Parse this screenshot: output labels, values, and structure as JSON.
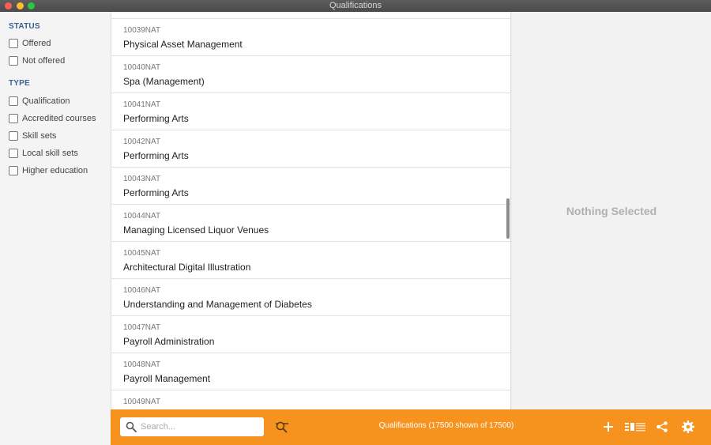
{
  "window": {
    "title": "Qualifications"
  },
  "sidebar": {
    "status_title": "STATUS",
    "status_items": [
      {
        "label": "Offered"
      },
      {
        "label": "Not offered"
      }
    ],
    "type_title": "TYPE",
    "type_items": [
      {
        "label": "Qualification"
      },
      {
        "label": "Accredited courses"
      },
      {
        "label": "Skill sets"
      },
      {
        "label": "Local skill sets"
      },
      {
        "label": "Higher education"
      }
    ]
  },
  "list": {
    "items": [
      {
        "code": "10039NAT",
        "name": "Physical Asset Management"
      },
      {
        "code": "10040NAT",
        "name": "Spa (Management)"
      },
      {
        "code": "10041NAT",
        "name": "Performing Arts"
      },
      {
        "code": "10042NAT",
        "name": "Performing Arts"
      },
      {
        "code": "10043NAT",
        "name": "Performing Arts"
      },
      {
        "code": "10044NAT",
        "name": "Managing Licensed Liquor Venues"
      },
      {
        "code": "10045NAT",
        "name": "Architectural Digital Illustration"
      },
      {
        "code": "10046NAT",
        "name": "Understanding and Management of Diabetes"
      },
      {
        "code": "10047NAT",
        "name": "Payroll Administration"
      },
      {
        "code": "10048NAT",
        "name": "Payroll Management"
      },
      {
        "code": "10049NAT",
        "name": ""
      }
    ]
  },
  "detail": {
    "empty_text": "Nothing Selected"
  },
  "toolbar": {
    "search_placeholder": "Search...",
    "status": "Qualifications (17500 shown of 17500)",
    "accent_color": "#f6921e",
    "icons": [
      "search-icon",
      "filter-icon",
      "add-icon",
      "layout-icon",
      "share-icon",
      "gear-icon"
    ]
  }
}
